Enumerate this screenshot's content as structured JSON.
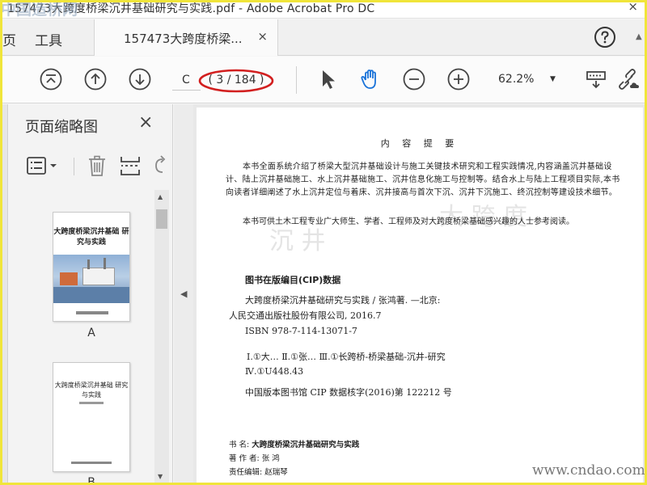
{
  "window": {
    "title": "157473大跨度桥梁沉井基础研究与实践.pdf - Adobe Acrobat Pro DC",
    "close_glyph": "×"
  },
  "watermark": {
    "top_left": "中国造桥网",
    "bottom_right": "www.cndao.com"
  },
  "tabs": {
    "home_label": "页",
    "tools_label": "工具",
    "document_label": "157473大跨度桥梁...",
    "document_close": "×"
  },
  "toolbar": {
    "page_input_value": "C",
    "page_count_text": "( 3 / 184 )",
    "zoom_value": "62.2%",
    "zoom_caret": "▼"
  },
  "thumbnails_panel": {
    "title": "页面缩略图",
    "close_glyph": "×",
    "thumbs": [
      {
        "label": "A",
        "title": "大跨度桥梁沉井基础 研究与实践"
      },
      {
        "label": "B",
        "title": "大跨度桥梁沉井基础 研究与实践"
      }
    ]
  },
  "page_content": {
    "heading": "内 容 提 要",
    "intro_para1": "本书全面系统介绍了桥梁大型沉井基础设计与施工关键技术研究和工程实践情况,内容涵盖沉井基础设计、陆上沉井基础施工、水上沉井基础施工、沉井信息化施工与控制等。结合水上与陆上工程项目实际,本书向读者详细阐述了水上沉井定位与着床、沉井接高与首次下沉、沉井下沉施工、终沉控制等建设技术细节。",
    "intro_para2": "本书可供土木工程专业广大师生、学者、工程师及对大跨度桥梁基础感兴趣的人士参考阅读。",
    "cip_heading": "图书在版编目(CIP)数据",
    "cip_line1": "大跨度桥梁沉井基础研究与实践 / 张鸿著. —北京:",
    "cip_line2": "人民交通出版社股份有限公司, 2016.7",
    "cip_line3": "ISBN  978-7-114-13071-7",
    "cip_line4": "Ⅰ.①大…   Ⅱ.①张…   Ⅲ.①长跨桥-桥梁基础-沉井-研究   Ⅳ.①U448.43",
    "cip_line5": "中国版本图书馆 CIP 数据核字(2016)第 122212 号",
    "book_name_label": "书    名:",
    "book_name": "大跨度桥梁沉井基础研究与实践",
    "author_label": "著 作 者:",
    "author": "张  鸿",
    "editor_label": "责任编辑:",
    "editor": "赵瑞琴"
  }
}
